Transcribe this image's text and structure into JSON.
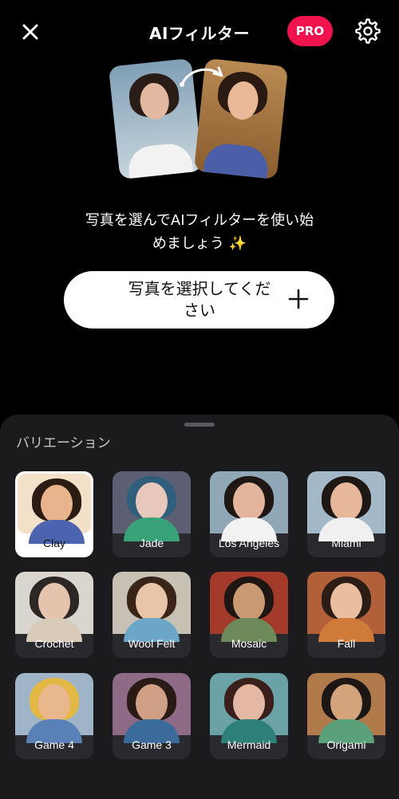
{
  "header": {
    "title": "AIフィルター",
    "pro_label": "PRO"
  },
  "icons": {
    "close": "close-icon",
    "settings": "gear-icon",
    "plus": "plus-icon",
    "arrow": "curved-arrow-icon"
  },
  "colors": {
    "accent": "#f0134d",
    "background": "#000000",
    "sheet": "#1b1b1d",
    "tile": "#2a2a2e"
  },
  "prompt": {
    "line1": "写真を選んでAIフィルターを使い始",
    "line2": "めましょう ✨"
  },
  "pick_button": {
    "line1": "写真を選択してくだ",
    "line2": "さい"
  },
  "sheet": {
    "title": "バリエーション"
  },
  "filters": [
    {
      "label": "Clay",
      "selected": true
    },
    {
      "label": "Jade"
    },
    {
      "label": "Los Angeles"
    },
    {
      "label": "Miami"
    },
    {
      "label": "Crochet"
    },
    {
      "label": "Wool Felt"
    },
    {
      "label": "Mosaic"
    },
    {
      "label": "Fall"
    },
    {
      "label": "Game 4"
    },
    {
      "label": "Game 3"
    },
    {
      "label": "Mermaid"
    },
    {
      "label": "Origami"
    }
  ]
}
